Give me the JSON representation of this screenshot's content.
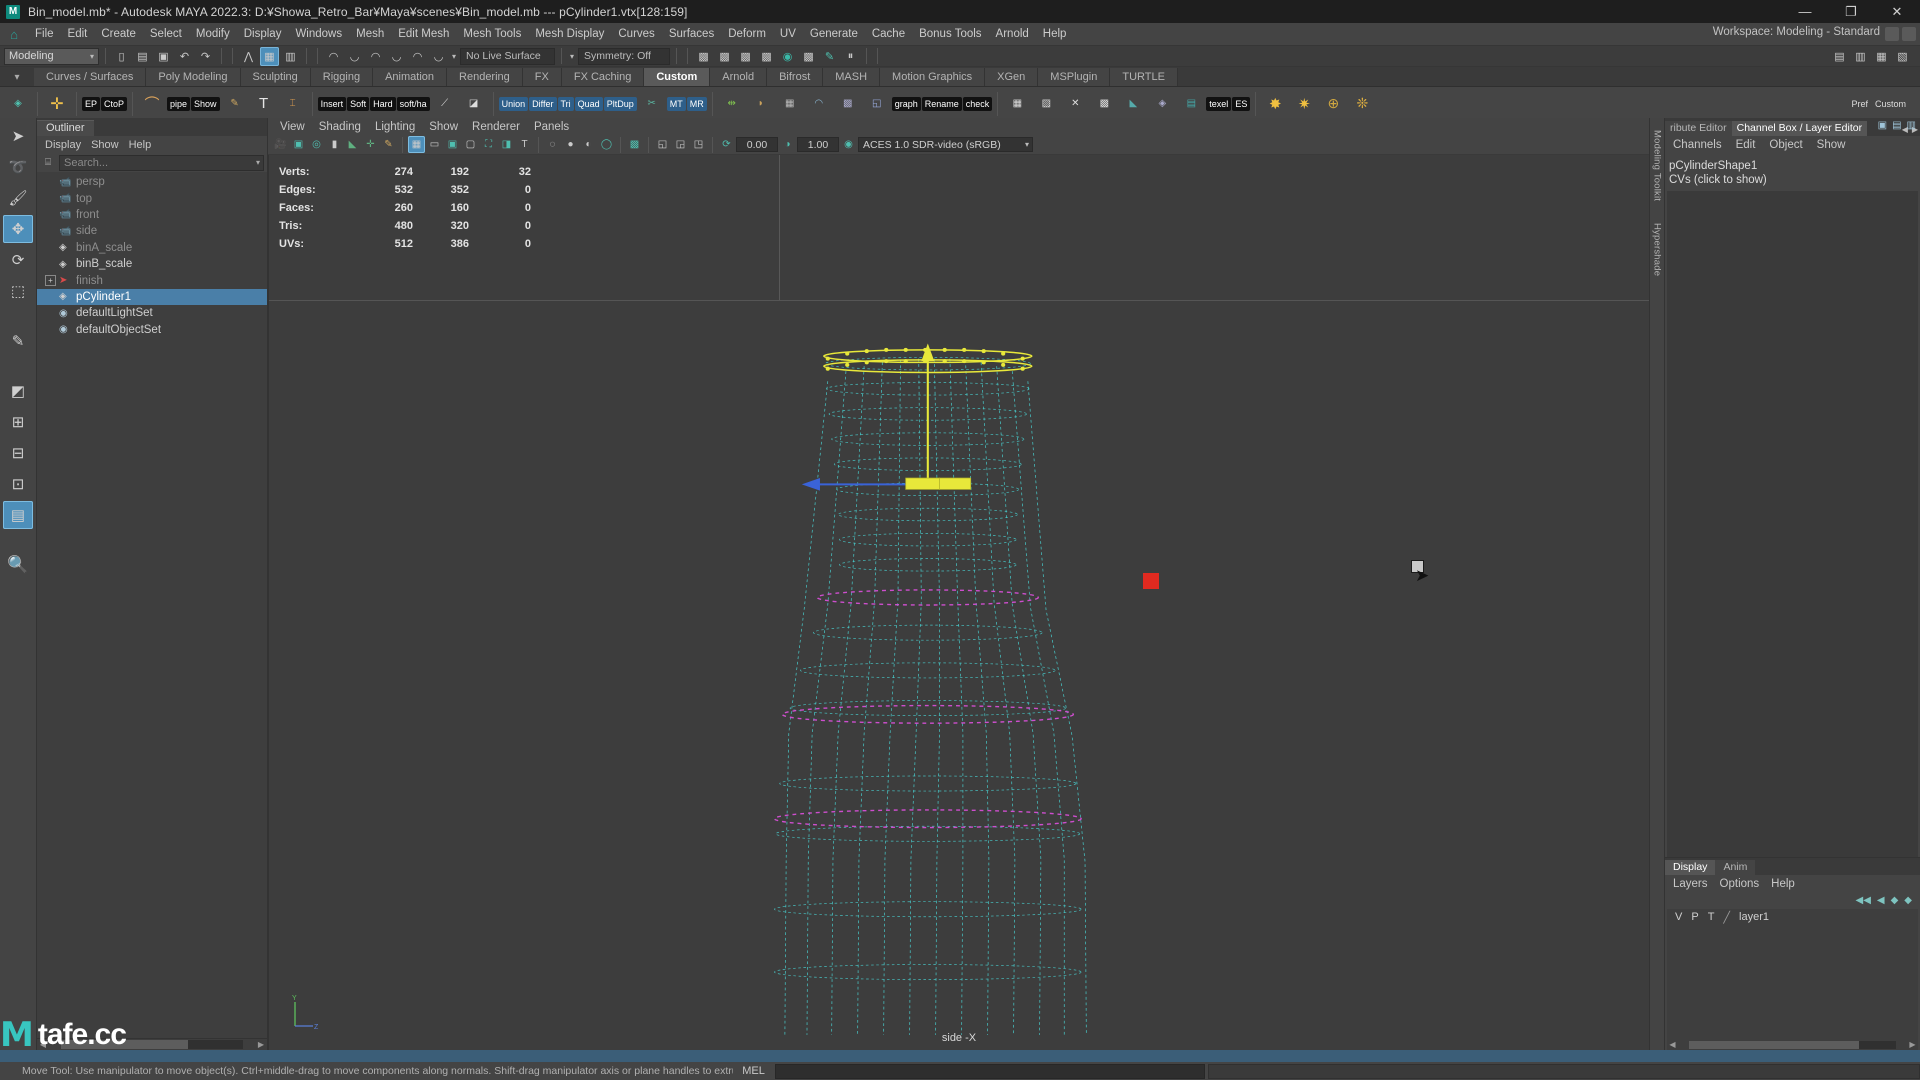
{
  "titlebar": {
    "title": "Bin_model.mb* - Autodesk MAYA 2022.3: D:¥Showa_Retro_Bar¥Maya¥scenes¥Bin_model.mb  ---  pCylinder1.vtx[128:159]",
    "logo": "M",
    "minimize": "—",
    "maximize": "❐",
    "close": "✕"
  },
  "menubar": {
    "home_icon": "⌂",
    "items": [
      "File",
      "Edit",
      "Create",
      "Select",
      "Modify",
      "Display",
      "Windows",
      "Mesh",
      "Edit Mesh",
      "Mesh Tools",
      "Mesh Display",
      "Curves",
      "Surfaces",
      "Deform",
      "UV",
      "Generate",
      "Cache",
      "Bonus Tools",
      "Arnold",
      "Help"
    ],
    "workspace_label": "Workspace: Modeling - Standard"
  },
  "statusline": {
    "menu_set": "Modeling",
    "live_surface": "No Live Surface",
    "symmetry": "Symmetry: Off"
  },
  "shelf": {
    "tabs": [
      "Curves / Surfaces",
      "Poly Modeling",
      "Sculpting",
      "Rigging",
      "Animation",
      "Rendering",
      "FX",
      "FX Caching",
      "Custom",
      "Arnold",
      "Bifrost",
      "MASH",
      "Motion Graphics",
      "XGen",
      "MSPlugin",
      "TURTLE"
    ],
    "active_tab": "Custom",
    "buttons": [
      "EP",
      "CtoP",
      "pipe",
      "Show",
      "Insert",
      "Soft",
      "Hard",
      "soft/ha",
      "Union",
      "Differ",
      "Tri",
      "Quad",
      "PltDup",
      "MT",
      "MR",
      "graph",
      "Rename",
      "check",
      "texel",
      "ES",
      "Pref",
      "Custom"
    ]
  },
  "outliner": {
    "tab_label": "Outliner",
    "menu": [
      "Display",
      "Show",
      "Help"
    ],
    "search_placeholder": "Search...",
    "items": [
      {
        "label": "persp",
        "icon": "camera",
        "dim": true,
        "selected": false,
        "expander": false,
        "indent": 1
      },
      {
        "label": "top",
        "icon": "camera",
        "dim": true,
        "selected": false,
        "expander": false,
        "indent": 1
      },
      {
        "label": "front",
        "icon": "camera",
        "dim": true,
        "selected": false,
        "expander": false,
        "indent": 1
      },
      {
        "label": "side",
        "icon": "camera",
        "dim": true,
        "selected": false,
        "expander": false,
        "indent": 1
      },
      {
        "label": "binA_scale",
        "icon": "mesh",
        "dim": true,
        "selected": false,
        "expander": false,
        "indent": 1
      },
      {
        "label": "binB_scale",
        "icon": "mesh",
        "dim": false,
        "selected": false,
        "expander": false,
        "indent": 1
      },
      {
        "label": "finish",
        "icon": "finish",
        "dim": true,
        "selected": false,
        "expander": true,
        "indent": 0
      },
      {
        "label": "pCylinder1",
        "icon": "mesh",
        "dim": false,
        "selected": true,
        "expander": false,
        "indent": 1
      },
      {
        "label": "defaultLightSet",
        "icon": "set",
        "dim": false,
        "selected": false,
        "expander": false,
        "indent": 1
      },
      {
        "label": "defaultObjectSet",
        "icon": "set",
        "dim": false,
        "selected": false,
        "expander": false,
        "indent": 1
      }
    ]
  },
  "viewport": {
    "menu": [
      "View",
      "Shading",
      "Lighting",
      "Show",
      "Renderer",
      "Panels"
    ],
    "exposure": "0.00",
    "gamma": "1.00",
    "color_management": "ACES 1.0 SDR-video (sRGB)",
    "camera_label": "side -X",
    "hud": {
      "rows": [
        {
          "label": "Verts:",
          "c1": "274",
          "c2": "192",
          "c3": "32"
        },
        {
          "label": "Edges:",
          "c1": "532",
          "c2": "352",
          "c3": "0"
        },
        {
          "label": "Faces:",
          "c1": "260",
          "c2": "160",
          "c3": "0"
        },
        {
          "label": "Tris:",
          "c1": "480",
          "c2": "320",
          "c3": "0"
        },
        {
          "label": "UVs:",
          "c1": "512",
          "c2": "386",
          "c3": "0"
        }
      ]
    },
    "axis": {
      "y": "Y",
      "z": "Z"
    }
  },
  "vertical_tabs": [
    "Modeling Toolkit",
    "Hypershade"
  ],
  "rightpanel": {
    "tabs": [
      "ribute Editor",
      "Channel Box / Layer Editor"
    ],
    "active_tab": "Channel Box / Layer Editor",
    "menu": [
      "Channels",
      "Edit",
      "Object",
      "Show"
    ],
    "node_name": "pCylinderShape1",
    "cv_label": "CVs (click to show)"
  },
  "layer_editor": {
    "tabs": [
      "Display",
      "Anim"
    ],
    "active_tab": "Display",
    "menu": [
      "Layers",
      "Options",
      "Help"
    ],
    "columns": [
      "V",
      "P",
      "T"
    ],
    "layers": [
      {
        "name": "layer1",
        "v": "",
        "p": "",
        "t": ""
      }
    ]
  },
  "bottom": {
    "help_text": "Move Tool: Use manipulator to move object(s). Ctrl+middle-drag to move components along normals. Shift-drag manipulator axis or plane handles to extrude components or clone objects. Ctrl+Shift+drag to cons",
    "mel_label": "MEL",
    "command_value": ""
  },
  "watermark": {
    "logo": "M",
    "text": "tafe.cc"
  },
  "colors": {
    "accent_blue": "#4d8fba",
    "selection_blue": "#4a7fa8",
    "teal": "#2aa198",
    "red_marker": "#e02a20",
    "panel_bg": "#444444",
    "viewport_bg": "#3d3d3d",
    "mesh_cyan": "#49d5d5",
    "mesh_magenta": "#d64fd6",
    "mesh_yellow": "#e8e83a"
  }
}
